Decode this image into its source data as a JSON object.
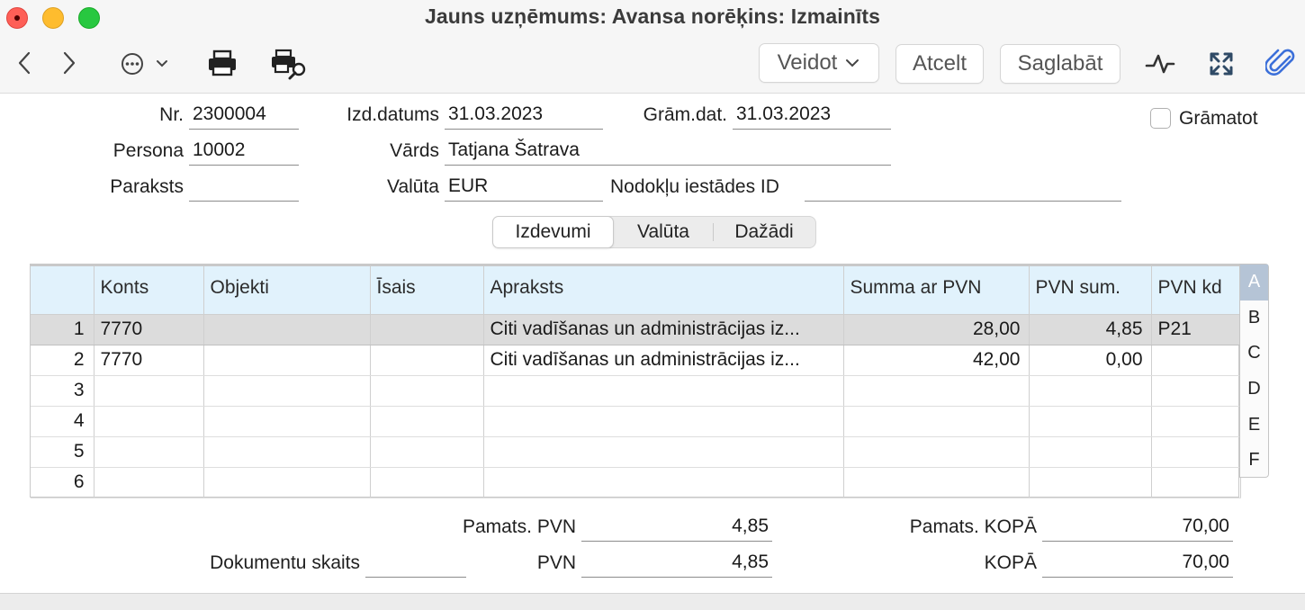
{
  "window": {
    "title": "Jauns uzņēmums: Avansa norēķins: Izmainīts"
  },
  "toolbar": {
    "create_label": "Veidot",
    "cancel_label": "Atcelt",
    "save_label": "Saglabāt"
  },
  "form": {
    "nr_label": "Nr.",
    "nr_value": "2300004",
    "issue_date_label": "Izd.datums",
    "issue_date_value": "31.03.2023",
    "book_date_label": "Grām.dat.",
    "book_date_value": "31.03.2023",
    "post_label": "Grāmatot",
    "person_label": "Persona",
    "person_value": "10002",
    "name_label": "Vārds",
    "name_value": "Tatjana Šatrava",
    "signature_label": "Paraksts",
    "signature_value": "",
    "currency_label": "Valūta",
    "currency_value": "EUR",
    "tax_id_label": "Nodokļu iestādes ID",
    "tax_id_value": ""
  },
  "tabs": [
    "Izdevumi",
    "Valūta",
    "Dažādi"
  ],
  "grid": {
    "columns": [
      "",
      "Konts",
      "Objekti",
      "Īsais",
      "Apraksts",
      "Summa ar PVN",
      "PVN sum.",
      "PVN kd"
    ],
    "rows": [
      {
        "n": "1",
        "konts": "7770",
        "objekti": "",
        "isais": "",
        "apraksts": "Citi vadīšanas un administrācijas iz...",
        "summa": "28,00",
        "pvn": "4,85",
        "kd": "P21"
      },
      {
        "n": "2",
        "konts": "7770",
        "objekti": "",
        "isais": "",
        "apraksts": "Citi vadīšanas un administrācijas iz...",
        "summa": "42,00",
        "pvn": "0,00",
        "kd": ""
      },
      {
        "n": "3",
        "konts": "",
        "objekti": "",
        "isais": "",
        "apraksts": "",
        "summa": "",
        "pvn": "",
        "kd": ""
      },
      {
        "n": "4",
        "konts": "",
        "objekti": "",
        "isais": "",
        "apraksts": "",
        "summa": "",
        "pvn": "",
        "kd": ""
      },
      {
        "n": "5",
        "konts": "",
        "objekti": "",
        "isais": "",
        "apraksts": "",
        "summa": "",
        "pvn": "",
        "kd": ""
      },
      {
        "n": "6",
        "konts": "",
        "objekti": "",
        "isais": "",
        "apraksts": "",
        "summa": "",
        "pvn": "",
        "kd": ""
      }
    ],
    "letters": [
      "A",
      "B",
      "C",
      "D",
      "E",
      "F"
    ]
  },
  "totals": {
    "base_vat_label": "Pamats. PVN",
    "base_vat_value": "4,85",
    "base_total_label": "Pamats. KOPĀ",
    "base_total_value": "70,00",
    "doc_count_label": "Dokumentu skaits",
    "doc_count_value": "",
    "vat_label": "PVN",
    "vat_value": "4,85",
    "total_label": "KOPĀ",
    "total_value": "70,00"
  },
  "colors": {
    "header_bg": "#e1f2fc",
    "selected_row": "#dcdcdc",
    "attachment_icon": "#3b6fd9"
  },
  "icons": [
    "back-icon",
    "forward-icon",
    "more-icon",
    "print-icon",
    "print-preview-icon",
    "chart-icon",
    "fullscreen-icon",
    "attachment-icon"
  ]
}
